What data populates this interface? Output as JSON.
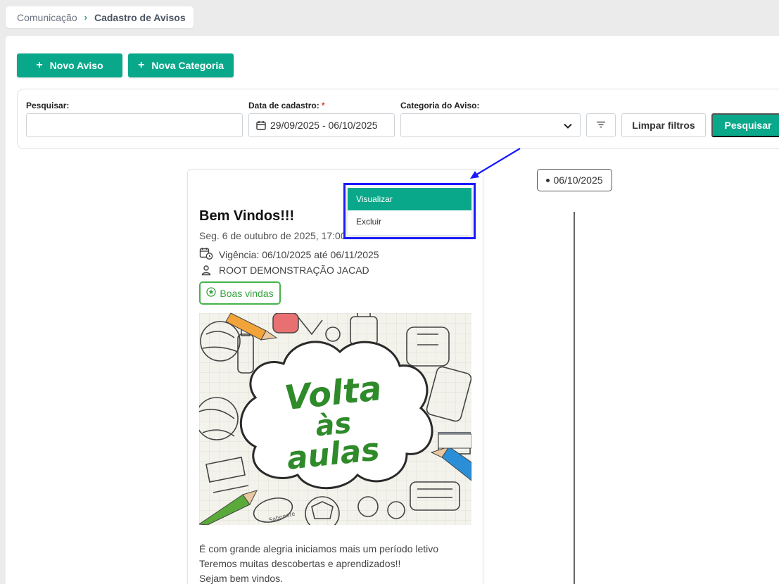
{
  "breadcrumb": {
    "parent": "Comunicação",
    "current": "Cadastro de Avisos"
  },
  "toolbar": {
    "new_notice_label": "Novo Aviso",
    "new_category_label": "Nova Categoria"
  },
  "filters": {
    "search_label": "Pesquisar:",
    "search_value": "",
    "date_label": "Data de cadastro:",
    "date_required": "*",
    "date_value": "29/09/2025 - 06/10/2025",
    "category_label": "Categoria do Aviso:",
    "category_value": "",
    "clear_label": "Limpar filtros",
    "search_button_label": "Pesquisar"
  },
  "card": {
    "title": "Bem Vindos!!!",
    "date": "Seg. 6 de outubro de 2025, 17:00",
    "validity": "Vigência: 06/10/2025 até 06/11/2025",
    "author": "ROOT DEMONSTRAÇÃO JACAD",
    "tag": "Boas vindas",
    "image_text": [
      "Volta",
      "às",
      "aulas"
    ],
    "image_small_text": "Sabonete",
    "body_lines": [
      "É com grande alegria iniciamos mais um período letivo",
      "Teremos muitas descobertas e aprendizados!!",
      "Sejam bem vindos."
    ]
  },
  "timeline": {
    "date": "06/10/2025"
  },
  "menu": {
    "items": [
      "Visualizar",
      "Excluir"
    ]
  },
  "colors": {
    "primary": "#0aa88a",
    "tag_green": "#46b34a",
    "highlight": "#1a1aff"
  }
}
